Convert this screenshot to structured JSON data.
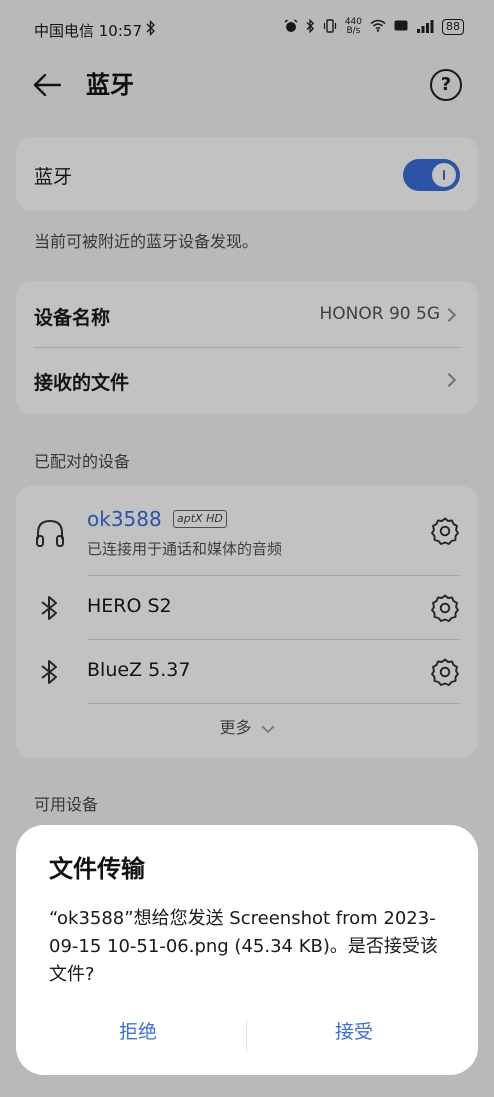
{
  "status_bar": {
    "carrier_time": "中国电信 10:57",
    "net_speed_value": "440",
    "net_speed_unit": "B/s",
    "battery": "88"
  },
  "header": {
    "title": "蓝牙"
  },
  "bluetooth_card": {
    "label": "蓝牙",
    "toggle_on": true
  },
  "visibility_note": "当前可被附近的蓝牙设备发现。",
  "info_card": {
    "device_name_label": "设备名称",
    "device_name_value": "HONOR 90 5G",
    "received_files_label": "接收的文件"
  },
  "paired_section": {
    "heading": "已配对的设备",
    "devices": [
      {
        "name": "ok3588",
        "codec": "aptX HD",
        "status": "已连接用于通话和媒体的音频",
        "icon": "headphones-icon"
      },
      {
        "name": "HERO S2",
        "icon": "bluetooth-icon"
      },
      {
        "name": "BlueZ 5.37",
        "icon": "bluetooth-icon"
      }
    ],
    "more_label": "更多"
  },
  "available_section": {
    "heading": "可用设备"
  },
  "dialog": {
    "title": "文件传输",
    "message": "“ok3588”想给您发送 Screenshot from 2023-09-15 10-51-06.png (45.34 KB)。是否接受该文件?",
    "decline_label": "拒绝",
    "accept_label": "接受"
  },
  "colors": {
    "accent": "#3c6ed9",
    "card_bg": "#ffffff",
    "page_bg": "#f1f3f5"
  }
}
